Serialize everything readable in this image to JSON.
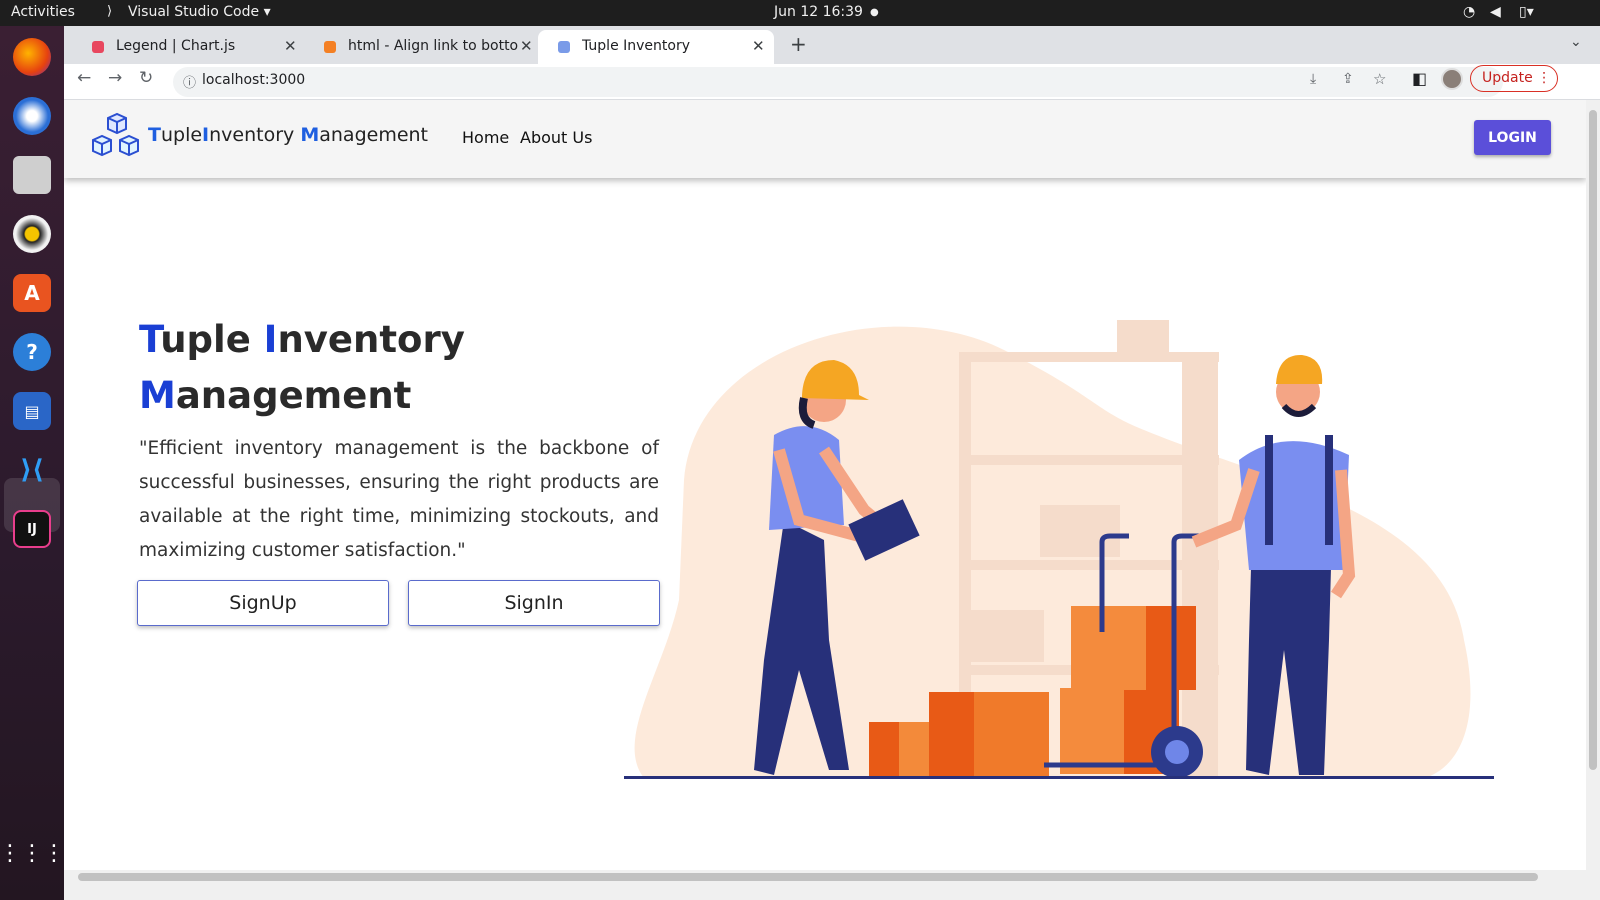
{
  "system": {
    "activities": "Activities",
    "app_menu": "Visual Studio Code",
    "datetime": "Jun 12  16:39"
  },
  "browser": {
    "tabs": [
      {
        "label": "Legend | Chart.js",
        "icon": "chartjs-icon"
      },
      {
        "label": "html - Align link to botton",
        "icon": "stackoverflow-icon"
      },
      {
        "label": "Tuple Inventory",
        "icon": "tuple-favicon"
      }
    ],
    "url": "localhost:3000",
    "update_label": "Update"
  },
  "site": {
    "brand": {
      "t1": "T",
      "p1": "uple",
      "t2": "I",
      "p2": "nventory ",
      "t3": "M",
      "p3": "anagement"
    },
    "nav": {
      "home": "Home",
      "about": "About Us",
      "login": "LOGIN"
    },
    "hero": {
      "title_a": "T",
      "title_b": "uple ",
      "title_c": "I",
      "title_d": "nventory",
      "title_e": "M",
      "title_f": "anagement",
      "quote": "\"Efficient inventory management is the backbone of successful businesses, ensuring the right products are available at the right time, minimizing stockouts, and maximizing customer satisfaction.\"",
      "signup": "SignUp",
      "signin": "SignIn"
    }
  },
  "colors": {
    "accent": "#5b4fd9",
    "brand_blue": "#1f5fe0"
  }
}
